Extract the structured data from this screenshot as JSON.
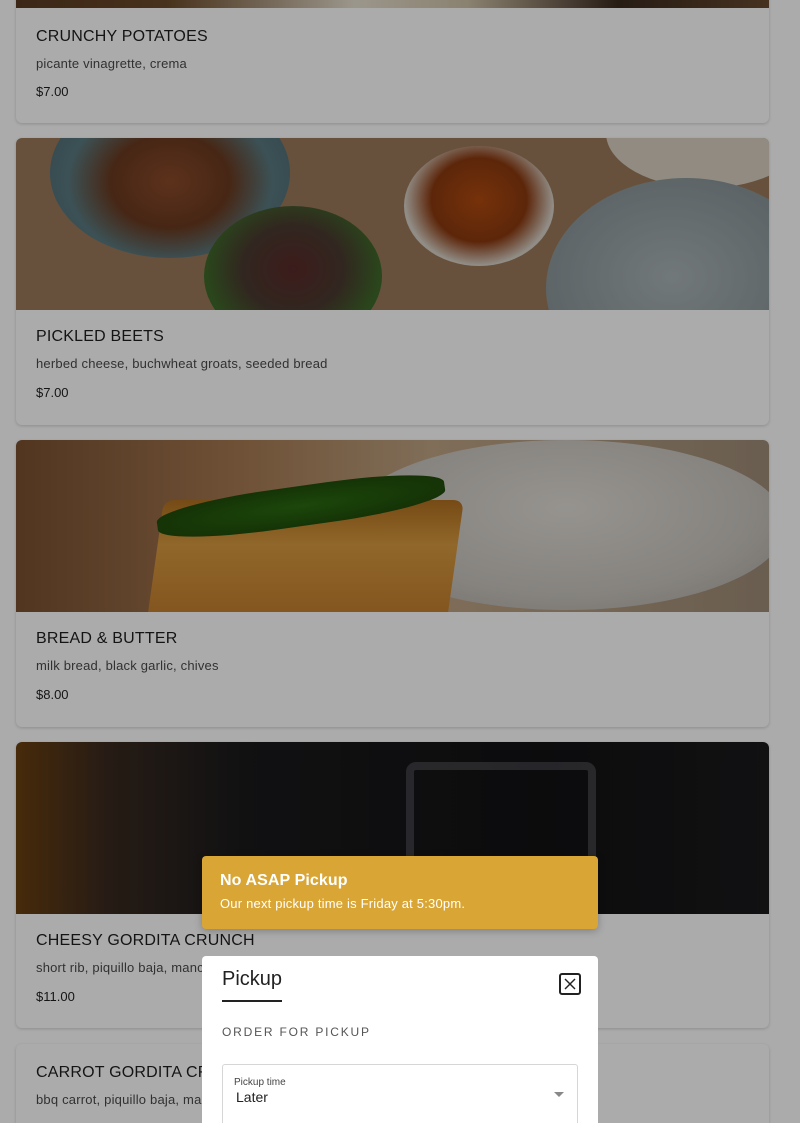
{
  "menu_items": [
    {
      "name": "CRUNCHY POTATOES",
      "description": "picante vinagrette, crema",
      "price": "$7.00"
    },
    {
      "name": "PICKLED BEETS",
      "description": "herbed cheese, buchwheat groats, seeded bread",
      "price": "$7.00"
    },
    {
      "name": "BREAD & BUTTER",
      "description": "milk bread, black garlic, chives",
      "price": "$8.00"
    },
    {
      "name": "CHEESY GORDITA CRUNCH",
      "description": "short rib, piquillo baja, manchego",
      "price": "$11.00"
    },
    {
      "name": "CARROT GORDITA CRUNCH",
      "description": "bbq carrot, piquillo baja, manchego",
      "price": ""
    }
  ],
  "toast": {
    "title": "No ASAP Pickup",
    "message": "Our next pickup time is Friday at 5:30pm."
  },
  "dialog": {
    "title": "Pickup",
    "section_label": "ORDER FOR PICKUP",
    "pickup_time_label": "Pickup time",
    "pickup_time_value": "Later",
    "close_icon": "close-icon",
    "caret_icon": "chevron-down-icon"
  },
  "colors": {
    "toast_background": "#d9a534",
    "overlay": "rgba(0,0,0,0.33)"
  }
}
